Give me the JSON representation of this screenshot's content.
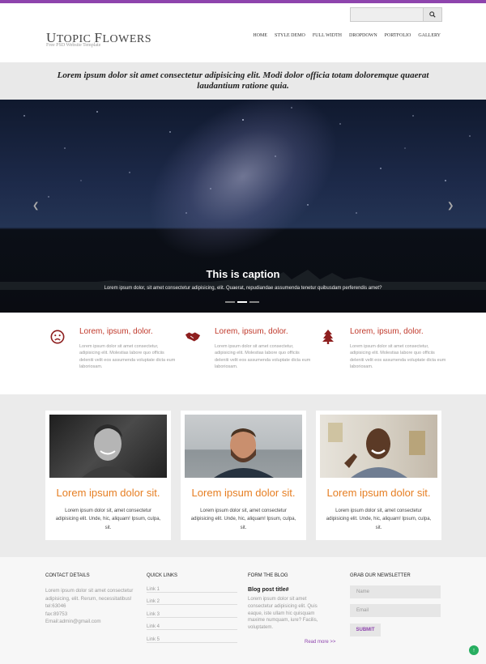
{
  "header": {
    "logo_text": "Utopic Flowers",
    "tagline": "Free PSD Website Template",
    "search": {
      "placeholder": "",
      "icon": "search-icon"
    },
    "nav": [
      "HOME",
      "STYLE DEMO",
      "FULL WIDTH",
      "DROPDOWN",
      "PORTFOLIO",
      "GALLERY"
    ]
  },
  "intro": {
    "text": "Lorem ipsum dolor sit amet consectetur adipisicing elit. Modi dolor officia totam doloremque quaerat laudantium ratione quia."
  },
  "slider": {
    "caption": "This is caption",
    "subcaption": "Lorem ipsum dolor, sit amet consectetur adipisicing, elit. Quaerat, repudiandae assumenda tenetur quibusdam perferendis amet?",
    "prev_icon": "chevron-left-icon",
    "next_icon": "chevron-right-icon",
    "active_slide": 2,
    "slide_count": 3
  },
  "features": [
    {
      "icon": "frown-face-icon",
      "title": "Lorem, ipsum, dolor.",
      "text": "Lorem ipsum dolor sit amet consectetur, adipisicing elit. Molestias labore quo officiis deleniti velit eos assumenda voluptate dicta eum laboriosam."
    },
    {
      "icon": "handshake-icon",
      "title": "Lorem, ipsum, dolor.",
      "text": "Lorem ipsum dolor sit amet consectetur, adipisicing elit. Molestias labore quo officiis deleniti velit eos assumenda voluptate dicta eum laboriosam."
    },
    {
      "icon": "tree-icon",
      "title": "Lorem, ipsum, dolor.",
      "text": "Lorem ipsum dolor sit amet consectetur, adipisicing elit. Molestias labore quo officiis deleniti velit eos assumenda voluptate dicta eum laboriosam."
    }
  ],
  "cards": [
    {
      "photo": "person-portrait",
      "title": "Lorem ipsum dolor sit.",
      "text": "Lorem ipsum dolor sit, amet consectetur adipisicing elit. Unde, hic, aliquam! Ipsum, culpa, sit."
    },
    {
      "photo": "person-portrait",
      "title": "Lorem ipsum dolor sit.",
      "text": "Lorem ipsum dolor sit, amet consectetur adipisicing elit. Unde, hic, aliquam! Ipsum, culpa, sit."
    },
    {
      "photo": "person-portrait",
      "title": "Lorem ipsum dolor sit.",
      "text": "Lorem ipsum dolor sit, amet consectetur adipisicing elit. Unde, hic, aliquam! Ipsum, culpa, sit."
    }
  ],
  "footer": {
    "contact": {
      "title": "CONTACT DETAILS",
      "text": "Lorem ipsum dolor sit amet consectetur adipisicing, elit. Rerum, necessitatibus!",
      "tel": "tel:63046",
      "fax": "fax:89753",
      "email": "Email:admin@gmail.com"
    },
    "quick_links": {
      "title": "QUICK LINKS",
      "links": [
        "Link 1",
        "Link 2",
        "Link 3",
        "Link 4",
        "Link 5"
      ]
    },
    "blog": {
      "title": "FORM THE BLOG",
      "post_title": "Blog post title#",
      "post_text": "Lorem ipsum dolor sit amet consectetur adipisicing elit. Quis eaque, iste ullam hic quisquam maxime numquam, iure? Facilis, voluptatem.",
      "read_more": "Read more >>"
    },
    "newsletter": {
      "title": "GRAB OUR NEWSLETTER",
      "name_placeholder": "Name",
      "email_placeholder": "Email",
      "submit": "SUBMIT"
    }
  },
  "colors": {
    "accent": "#8e44ad",
    "feature_title": "#c0392b",
    "card_title": "#e67e22"
  }
}
